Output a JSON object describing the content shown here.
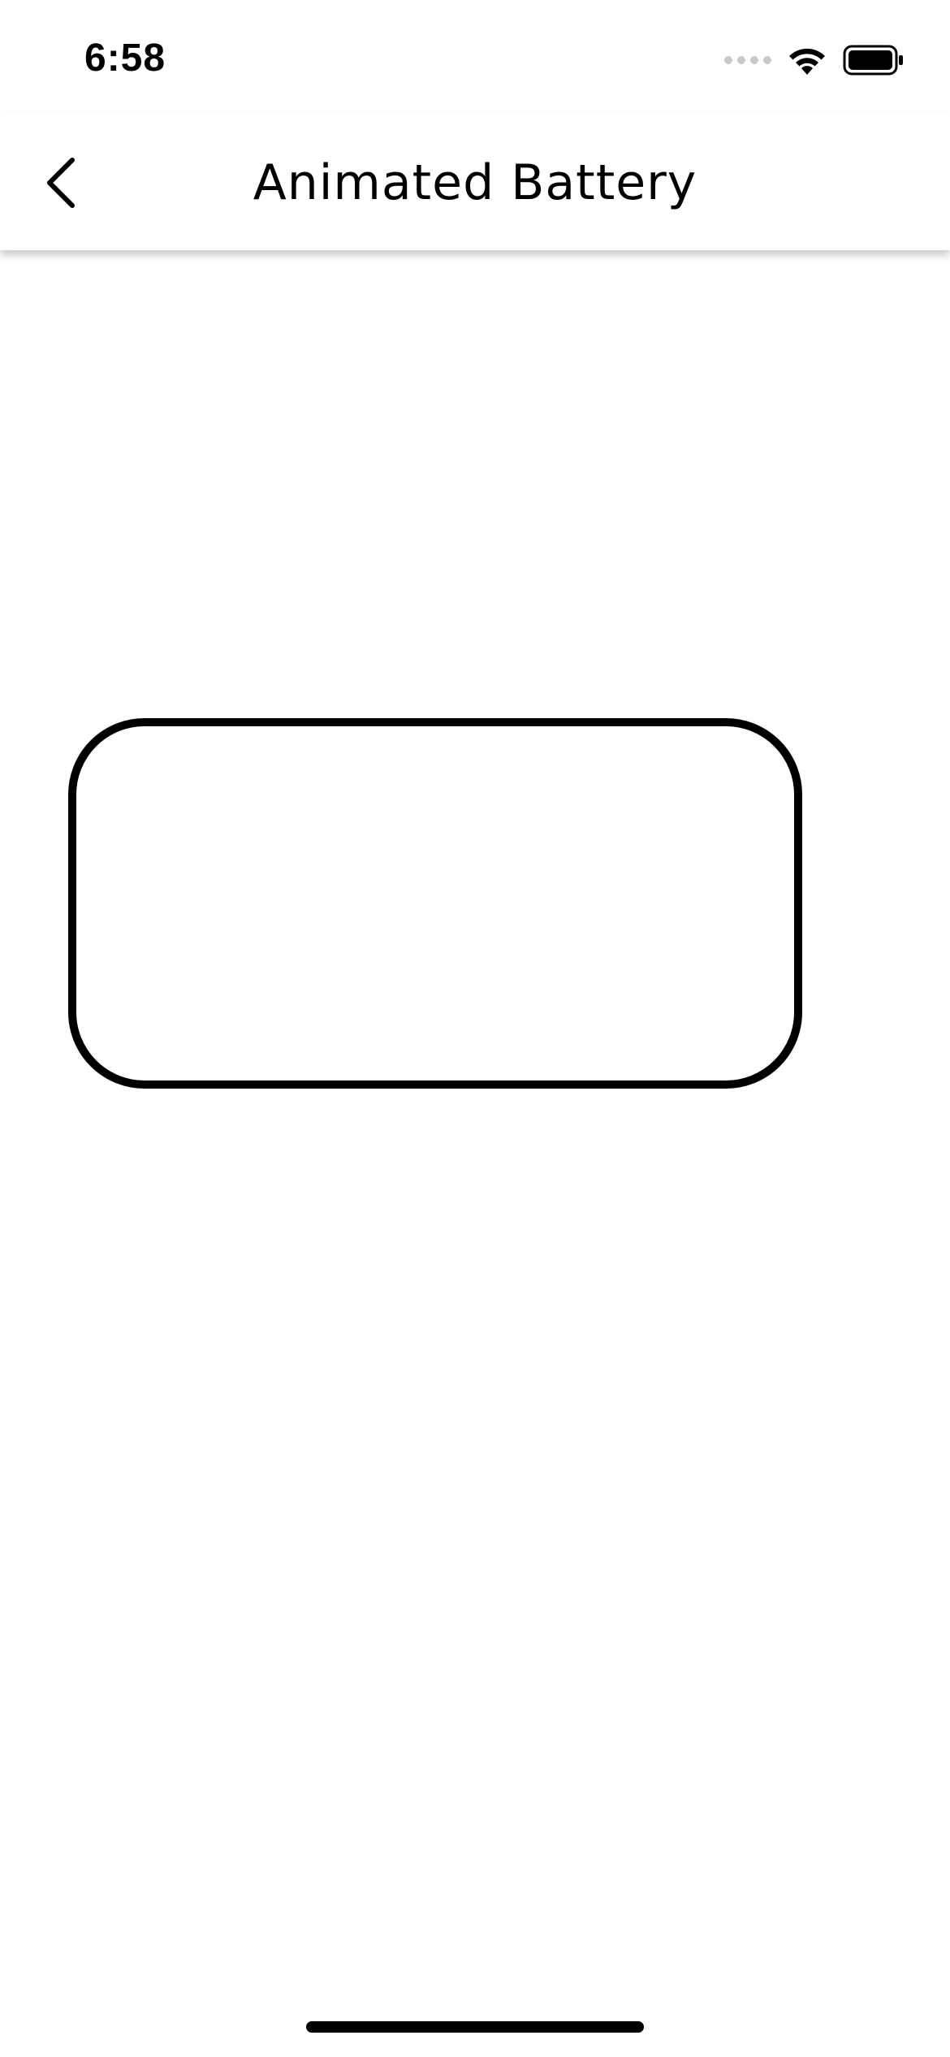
{
  "status_bar": {
    "time": "6:58",
    "icons": [
      "cellular-signal-icon",
      "wifi-icon",
      "battery-icon"
    ]
  },
  "nav_bar": {
    "title": "Animated Battery",
    "back_icon": "chevron-left-icon"
  },
  "battery_widget": {
    "charge_fraction": 0,
    "outline_color": "#000000",
    "fill_color": "#4caf50"
  },
  "colors": {
    "background": "#ffffff",
    "text": "#000000"
  }
}
